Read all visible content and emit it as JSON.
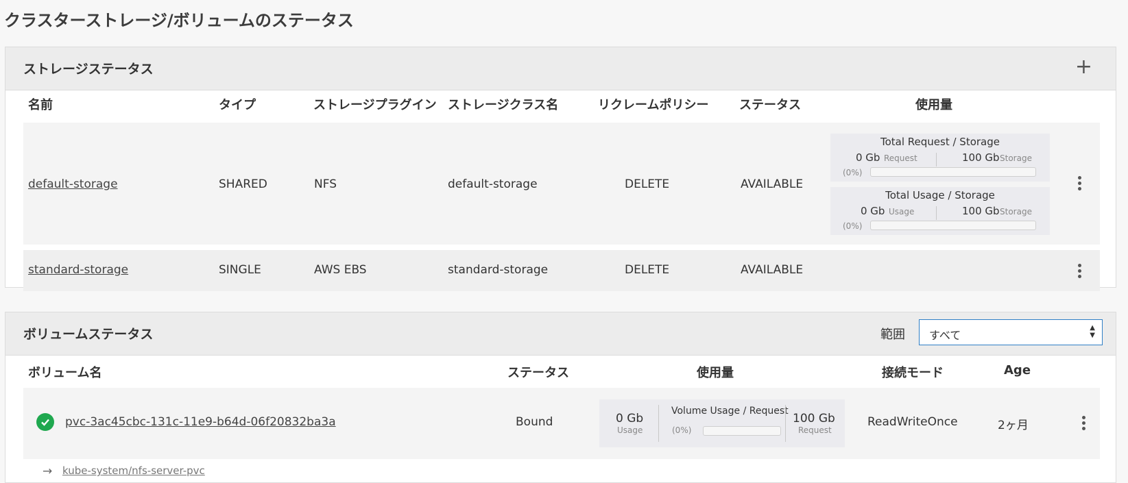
{
  "page": {
    "title": "クラスターストレージ/ボリュームのステータス"
  },
  "storage": {
    "title": "ストレージステータス",
    "add_icon": "plus-icon",
    "columns": {
      "name": "名前",
      "type": "タイプ",
      "plugin": "ストレージプラグイン",
      "class": "ストレージクラス名",
      "reclaim": "リクレームポリシー",
      "status": "ステータス",
      "usage": "使用量"
    },
    "rows": [
      {
        "name": "default-storage",
        "type": "SHARED",
        "plugin": "NFS",
        "class": "default-storage",
        "reclaim": "DELETE",
        "status": "AVAILABLE",
        "request_usage": {
          "title": "Total Request / Storage",
          "left_value": "0 Gb",
          "left_label": "Request",
          "right_value": "100 Gb",
          "right_label": "Storage",
          "percent": "(0%)",
          "fraction": 0
        },
        "usage_usage": {
          "title": "Total Usage / Storage",
          "left_value": "0 Gb",
          "left_label": "Usage",
          "right_value": "100 Gb",
          "right_label": "Storage",
          "percent": "(0%)",
          "fraction": 0
        }
      },
      {
        "name": "standard-storage",
        "type": "SINGLE",
        "plugin": "AWS EBS",
        "class": "standard-storage",
        "reclaim": "DELETE",
        "status": "AVAILABLE"
      }
    ]
  },
  "volume": {
    "title": "ボリュームステータス",
    "range_label": "範囲",
    "range_value": "すべて",
    "columns": {
      "name": "ボリューム名",
      "status": "ステータス",
      "usage": "使用量",
      "mode": "接続モード",
      "age": "Age"
    },
    "rows": [
      {
        "name": "pvc-3ac45cbc-131c-11e9-b64d-06f20832ba3a",
        "status": "Bound",
        "usage_value": "0 Gb",
        "usage_label": "Usage",
        "usage_title": "Volume Usage / Request",
        "percent": "(0%)",
        "fraction": 0,
        "request_value": "100 Gb",
        "request_label": "Request",
        "mode": "ReadWriteOnce",
        "age": "2ヶ月",
        "claim": "kube-system/nfs-server-pvc"
      }
    ]
  },
  "colors": {
    "accent": "#2f7fc6",
    "success": "#1fa84f",
    "header_bg": "#ececec"
  }
}
